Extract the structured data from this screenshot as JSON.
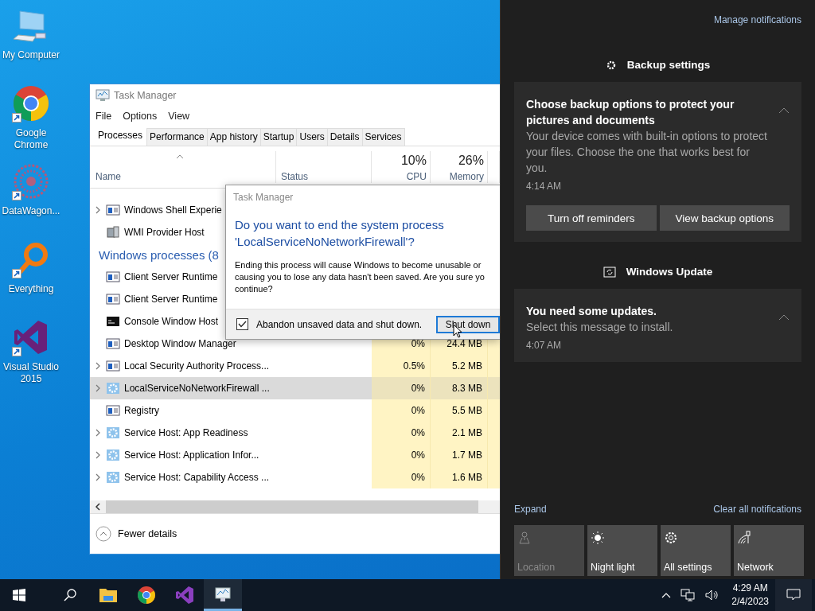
{
  "desktop_icons": [
    {
      "label": "My Computer",
      "kind": "computer",
      "shortcut": false
    },
    {
      "label": "Google Chrome",
      "kind": "browser",
      "shortcut": true
    },
    {
      "label": "DataWagon...",
      "kind": "flower",
      "shortcut": true
    },
    {
      "label": "Everything",
      "kind": "magnifier",
      "shortcut": true
    },
    {
      "label": "Visual Studio 2015",
      "kind": "bowtie",
      "shortcut": true
    }
  ],
  "task_manager": {
    "title": "Task Manager",
    "menu": [
      "File",
      "Options",
      "View"
    ],
    "tabs": [
      {
        "label": "Processes",
        "selected": true
      },
      {
        "label": "Performance",
        "selected": false
      },
      {
        "label": "App history",
        "selected": false
      },
      {
        "label": "Startup",
        "selected": false
      },
      {
        "label": "Users",
        "selected": false
      },
      {
        "label": "Details",
        "selected": false
      },
      {
        "label": "Services",
        "selected": false
      }
    ],
    "columns": {
      "name": "Name",
      "status": "Status",
      "cpu_total": "10%",
      "cpu": "CPU",
      "memory_total": "26%",
      "memory": "Memory"
    },
    "rows": [
      {
        "kind": "window",
        "name": "Windows Shell Experie",
        "expandable": true,
        "selected": false
      },
      {
        "kind": "server",
        "name": "WMI Provider Host",
        "expandable": false,
        "selected": false
      },
      {
        "kind": "group",
        "name": "Windows processes (8"
      },
      {
        "kind": "window",
        "name": "Client Server Runtime",
        "expandable": false,
        "selected": false
      },
      {
        "kind": "window",
        "name": "Client Server Runtime",
        "expandable": false,
        "selected": false
      },
      {
        "kind": "console",
        "name": "Console Window Host",
        "expandable": false,
        "selected": false
      },
      {
        "kind": "window",
        "name": "Desktop Window Manager",
        "expandable": false,
        "selected": false,
        "cpu": "0%",
        "memory": "24.4 MB"
      },
      {
        "kind": "window",
        "name": "Local Security Authority Process...",
        "expandable": true,
        "selected": false,
        "cpu": "0.5%",
        "memory": "5.2 MB"
      },
      {
        "kind": "gear",
        "name": "LocalServiceNoNetworkFirewall ...",
        "expandable": true,
        "selected": true,
        "cpu": "0%",
        "memory": "8.3 MB"
      },
      {
        "kind": "window",
        "name": "Registry",
        "expandable": false,
        "selected": false,
        "cpu": "0%",
        "memory": "5.5 MB"
      },
      {
        "kind": "gear",
        "name": "Service Host: App Readiness",
        "expandable": true,
        "selected": false,
        "cpu": "0%",
        "memory": "2.1 MB"
      },
      {
        "kind": "gear",
        "name": "Service Host: Application Infor...",
        "expandable": true,
        "selected": false,
        "cpu": "0%",
        "memory": "1.7 MB"
      },
      {
        "kind": "gear",
        "name": "Service Host: Capability Access ...",
        "expandable": true,
        "selected": false,
        "cpu": "0%",
        "memory": "1.6 MB"
      }
    ],
    "footer": "Fewer details"
  },
  "dialog": {
    "title": "Task Manager",
    "heading": "Do you want to end the system process 'LocalServiceNoNetworkFirewall'?",
    "message_lines": [
      "Ending this process will cause Windows to become unusable or",
      "causing you to lose any data hasn't been saved. Are you sure yo",
      "continue?"
    ],
    "checkbox": {
      "label": "Abandon unsaved data and shut down.",
      "checked": true
    },
    "button": "Shut down"
  },
  "action_center": {
    "manage": "Manage notifications",
    "groups": [
      {
        "app": "Backup settings",
        "kind": "gear",
        "notifications": [
          {
            "title": "Choose backup options to protect your pictures and documents",
            "body": "Your device comes with built-in options to protect your files. Choose the one that works best for you.",
            "time": "4:14 AM",
            "actions": [
              "Turn off reminders",
              "View backup options"
            ]
          }
        ]
      },
      {
        "app": "Windows Update",
        "kind": "update",
        "notifications": [
          {
            "title": "You need some updates.",
            "body": "Select this message to install.",
            "time": "4:07 AM"
          }
        ]
      }
    ],
    "expand": "Expand",
    "clear": "Clear all notifications",
    "quick_actions": [
      {
        "label": "Location",
        "kind": "location",
        "disabled": true
      },
      {
        "label": "Night light",
        "kind": "brightness",
        "disabled": false
      },
      {
        "label": "All settings",
        "kind": "settings",
        "disabled": false
      },
      {
        "label": "Network",
        "kind": "network",
        "disabled": false
      }
    ]
  },
  "taskbar": {
    "apps": [
      {
        "kind": "folder",
        "active": false
      },
      {
        "kind": "browser",
        "active": false
      },
      {
        "kind": "bowtie",
        "active": false
      },
      {
        "kind": "monitor",
        "active": true
      }
    ],
    "time": "4:29 AM",
    "date": "2/4/2023"
  }
}
